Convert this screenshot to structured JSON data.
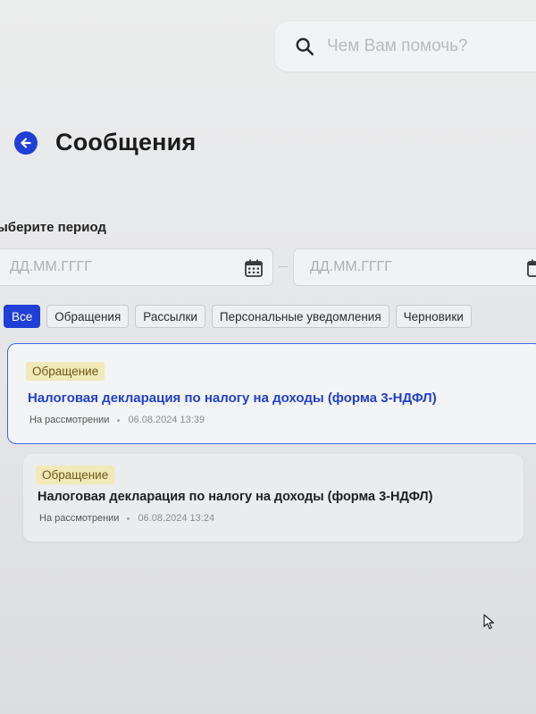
{
  "search": {
    "placeholder": "Чем Вам помочь?",
    "icon": "search-icon"
  },
  "header": {
    "back_icon": "arrow-left-icon",
    "title": "Сообщения"
  },
  "period": {
    "label": "ыберите период",
    "from_placeholder": "ДД.ММ.ГГГГ",
    "to_placeholder": "ДД.ММ.ГГГГ",
    "separator": "–",
    "icon": "calendar-icon"
  },
  "filters": [
    {
      "label": "Все",
      "active": true
    },
    {
      "label": "Обращения",
      "active": false
    },
    {
      "label": "Рассылки",
      "active": false
    },
    {
      "label": "Персональные уведомления",
      "active": false
    },
    {
      "label": "Черновики",
      "active": false
    }
  ],
  "messages": [
    {
      "type": "Обращение",
      "title": "Налоговая декларация по налогу на доходы (форма 3-НДФЛ)",
      "status": "На рассмотрении",
      "datetime": "06.08.2024 13:39",
      "selected": true
    },
    {
      "type": "Обращение",
      "title": "Налоговая декларация по налогу на доходы (форма 3-НДФЛ)",
      "status": "На рассмотрении",
      "datetime": "06.08.2024 13:24",
      "selected": false
    }
  ],
  "colors": {
    "accent": "#1f3fd6",
    "badge_bg": "#f1e9b8",
    "badge_text": "#6c5a1c",
    "selected_border": "#4666e0"
  }
}
